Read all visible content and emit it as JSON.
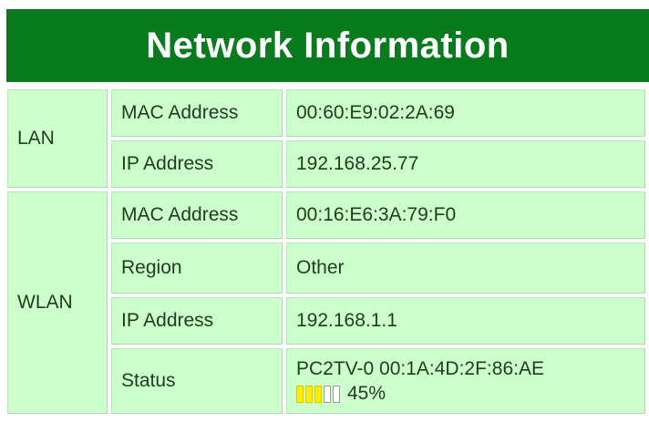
{
  "page": {
    "title": "Network Information"
  },
  "colors": {
    "header_bg": "#0a7a1f",
    "header_text": "#ffffff",
    "cell_bg": "#ccffcc",
    "signal_on": "#ffee00",
    "signal_off": "#ffffff"
  },
  "lan": {
    "label": "LAN",
    "mac_label": "MAC Address",
    "mac_value": "00:60:E9:02:2A:69",
    "ip_label": "IP Address",
    "ip_value": "192.168.25.77"
  },
  "wlan": {
    "label": "WLAN",
    "mac_label": "MAC Address",
    "mac_value": "00:16:E6:3A:79:F0",
    "region_label": "Region",
    "region_value": "Other",
    "ip_label": "IP Address",
    "ip_value": "192.168.1.1",
    "status_label": "Status",
    "status_value": "PC2TV-0 00:1A:4D:2F:86:AE",
    "signal_percent_text": "45%",
    "signal_bars_filled": 3,
    "signal_bars_total": 5
  }
}
